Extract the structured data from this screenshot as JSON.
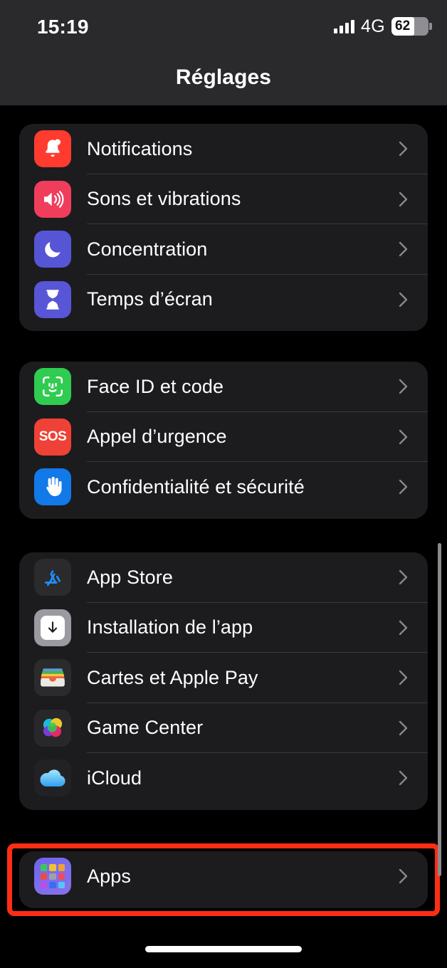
{
  "status_bar": {
    "time": "15:19",
    "network": "4G",
    "battery_percent": "62",
    "signal_icon": "cellular-bars-icon",
    "battery_icon": "battery-icon"
  },
  "header": {
    "title": "Réglages"
  },
  "groups": [
    {
      "name": "group-notifications",
      "rows": [
        {
          "label": "Notifications",
          "icon": "bell-icon",
          "icon_class": "ic-notif"
        },
        {
          "label": "Sons et vibrations",
          "icon": "speaker-wave-icon",
          "icon_class": "ic-sound"
        },
        {
          "label": "Concentration",
          "icon": "moon-icon",
          "icon_class": "ic-focus"
        },
        {
          "label": "Temps d’écran",
          "icon": "hourglass-icon",
          "icon_class": "ic-screen"
        }
      ]
    },
    {
      "name": "group-security",
      "rows": [
        {
          "label": "Face ID et code",
          "icon": "face-id-icon",
          "icon_class": "ic-faceid"
        },
        {
          "label": "Appel d’urgence",
          "icon": "sos-icon",
          "icon_class": "ic-sos"
        },
        {
          "label": "Confidentialité et sécurité",
          "icon": "hand-raised-icon",
          "icon_class": "ic-priv"
        }
      ]
    },
    {
      "name": "group-services",
      "rows": [
        {
          "label": "App Store",
          "icon": "app-store-icon",
          "icon_class": "ic-appstore"
        },
        {
          "label": "Installation de l’app",
          "icon": "download-arrow-icon",
          "icon_class": "ic-install"
        },
        {
          "label": "Cartes et Apple Pay",
          "icon": "wallet-icon",
          "icon_class": "ic-wallet"
        },
        {
          "label": "Game Center",
          "icon": "game-center-icon",
          "icon_class": "ic-gc"
        },
        {
          "label": "iCloud",
          "icon": "icloud-icon",
          "icon_class": "ic-icloud"
        }
      ]
    },
    {
      "name": "group-apps",
      "highlighted": true,
      "highlight_color": "#ff2d16",
      "rows": [
        {
          "label": "Apps",
          "icon": "apps-grid-icon",
          "icon_class": "ic-apps"
        }
      ]
    }
  ],
  "chevron_icon": "chevron-right-icon",
  "scrollbar": {
    "name": "vertical-scrollbar"
  },
  "home_indicator": {
    "name": "home-indicator"
  },
  "colors": {
    "background": "#000000",
    "card": "#1c1c1e",
    "separator": "#38383a",
    "header": "#2a2a2c",
    "text": "#ffffff",
    "chevron": "#8a8a8e",
    "highlight": "#ff2d16"
  }
}
